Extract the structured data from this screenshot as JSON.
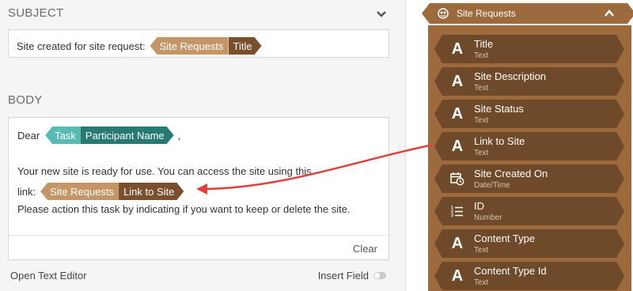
{
  "subject": {
    "label": "SUBJECT",
    "text": "Site created for site request:",
    "token": {
      "group": "Site Requests",
      "field": "Title"
    }
  },
  "body": {
    "label": "BODY",
    "greeting": "Dear",
    "greeting_token": {
      "group": "Task",
      "field": "Participant Name"
    },
    "greeting_suffix": ",",
    "line1": "Your new site is ready for use. You can access the site using this",
    "line2_prefix": "link:",
    "link_token": {
      "group": "Site Requests",
      "field": "Link to Site"
    },
    "line3": "Please action this task by indicating if you want to keep or delete the site.",
    "clear_label": "Clear"
  },
  "footer": {
    "open_editor": "Open Text Editor",
    "insert_field": "Insert Field"
  },
  "panel": {
    "title": "Site Requests",
    "fields": [
      {
        "name": "Title",
        "type": "Text",
        "icon": "text-icon"
      },
      {
        "name": "Site Description",
        "type": "Text",
        "icon": "text-icon"
      },
      {
        "name": "Site Status",
        "type": "Text",
        "icon": "text-icon"
      },
      {
        "name": "Link to Site",
        "type": "Text",
        "icon": "text-icon"
      },
      {
        "name": "Site Created On",
        "type": "Date/Time",
        "icon": "calendar-clock-icon"
      },
      {
        "name": "ID",
        "type": "Number",
        "icon": "number-list-icon"
      },
      {
        "name": "Content Type",
        "type": "Text",
        "icon": "text-icon"
      },
      {
        "name": "Content Type Id",
        "type": "Text",
        "icon": "text-icon"
      }
    ]
  },
  "colors": {
    "token_light": "#c49566",
    "token_dark": "#7a4f2e",
    "task_light": "#57bab3",
    "task_dark": "#267a72",
    "panel_bg": "#9c6a3c",
    "field_bg": "#6f4a2a",
    "arrow": "#e0413a"
  }
}
